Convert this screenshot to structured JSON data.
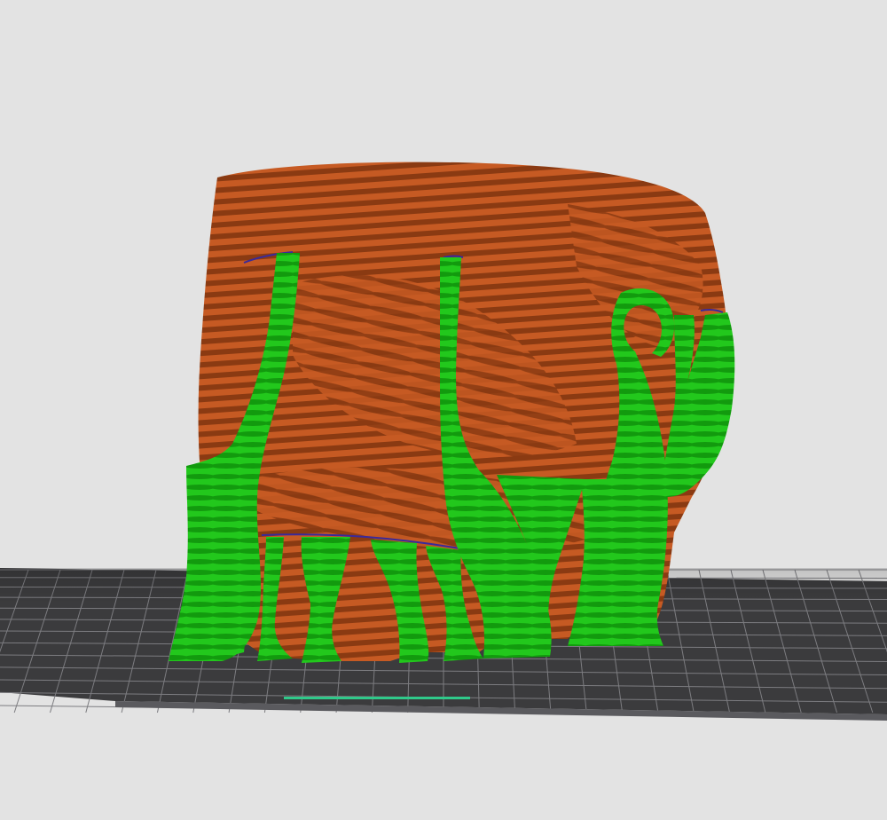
{
  "viewport": {
    "background_color": "#e3e3e3"
  },
  "build_plate": {
    "surface_color": "#3b3b3d",
    "grid_color": "#7c7c80",
    "edge_color": "#5a5a5e",
    "front_strip_accent_color": "#2fc98a"
  },
  "sliced_model": {
    "wall_color": "#c65a23",
    "wall_stripe_color": "#8a3a12",
    "support_color": "#22c81c",
    "support_stripe_color": "#129a0e",
    "seam_color": "#3a2a9a"
  }
}
